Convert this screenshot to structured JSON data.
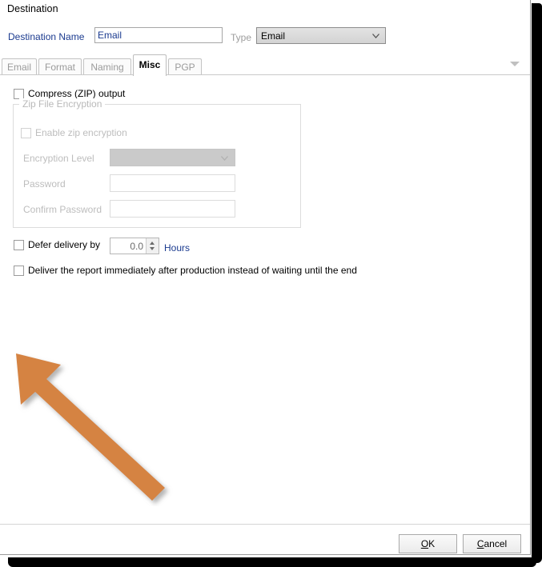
{
  "dialog": {
    "title": "Destination",
    "destination_name_label": "Destination Name",
    "destination_name_value": "Email",
    "type_label": "Type",
    "type_value": "Email",
    "type_chevron_icon": "chevron-down-icon",
    "tab_overflow_icon": "chevron-down-icon"
  },
  "tabs": [
    {
      "label": "Email",
      "active": false
    },
    {
      "label": "Format",
      "active": false
    },
    {
      "label": "Naming",
      "active": false
    },
    {
      "label": "Misc",
      "active": true
    },
    {
      "label": "PGP",
      "active": false
    }
  ],
  "misc_tab": {
    "compress_zip": {
      "label": "Compress (ZIP) output",
      "checked": false,
      "enabled": true
    },
    "zip_encryption_group": {
      "title": "Zip File Encryption",
      "enabled": false,
      "enable_zip_encryption": {
        "label": "Enable zip encryption",
        "checked": false
      },
      "encryption_level": {
        "label": "Encryption Level",
        "value": "",
        "chevron_icon": "chevron-down-icon"
      },
      "password": {
        "label": "Password",
        "value": ""
      },
      "confirm_password": {
        "label": "Confirm Password",
        "value": ""
      }
    },
    "defer_delivery": {
      "label": "Defer delivery by",
      "checked": false,
      "value": "0.0",
      "units": "Hours",
      "spinner_up_icon": "caret-up-icon",
      "spinner_down_icon": "caret-down-icon"
    },
    "deliver_immediately": {
      "label": "Deliver the report immediately after production instead of waiting until the end",
      "checked": false
    }
  },
  "buttons": {
    "ok": "OK",
    "ok_accel": "O",
    "ok_rest": "K",
    "cancel_lead": "C",
    "cancel_rest": "ancel"
  },
  "annotation": {
    "arrow_icon": "arrow-up-left-icon",
    "arrow_color": "#d58343",
    "points_at": "deliver-immediately-checkbox"
  },
  "colors": {
    "link_blue": "#1a3a8f",
    "disabled_gray": "#bdbdbd",
    "accent_orange": "#d58343"
  }
}
